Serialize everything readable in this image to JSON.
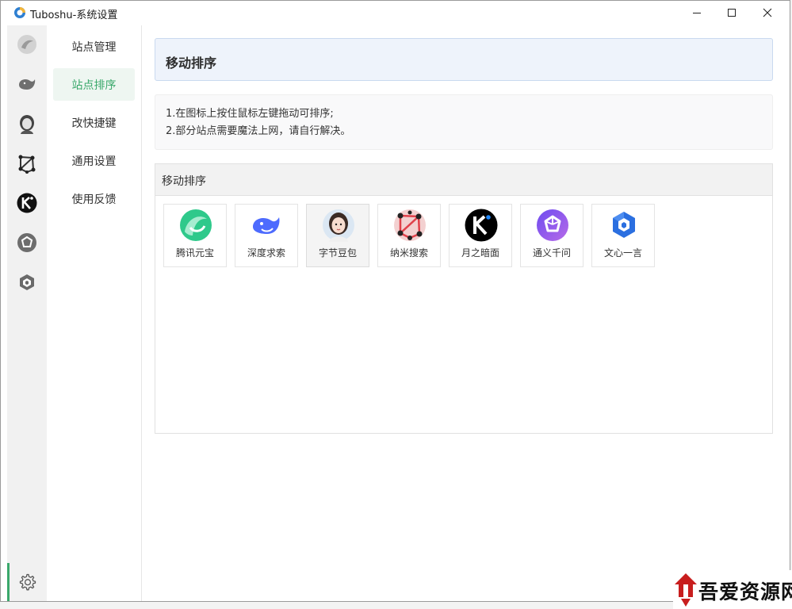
{
  "window": {
    "title": "Tuboshu-系统设置"
  },
  "title_controls": {
    "minimize": "minimize-icon",
    "maximize": "maximize-icon",
    "close": "close-icon"
  },
  "iconbar": {
    "items": [
      {
        "name": "tencent-yuanbao",
        "icon": "yuanbao-icon"
      },
      {
        "name": "deepseek",
        "icon": "deepseek-whale-icon"
      },
      {
        "name": "doubao",
        "icon": "doubao-avatar-icon"
      },
      {
        "name": "nami-search",
        "icon": "nami-network-icon"
      },
      {
        "name": "kimi",
        "icon": "kimi-k-icon"
      },
      {
        "name": "tongyi-qianwen",
        "icon": "tongyi-icon"
      },
      {
        "name": "wenxin-yiyan",
        "icon": "wenxin-cube-icon"
      }
    ],
    "settings_icon": "gear-icon"
  },
  "nav": {
    "items": [
      {
        "label": "站点管理",
        "active": false
      },
      {
        "label": "站点排序",
        "active": true
      },
      {
        "label": "改快捷键",
        "active": false
      },
      {
        "label": "通用设置",
        "active": false
      },
      {
        "label": "使用反馈",
        "active": false
      }
    ]
  },
  "main": {
    "title": "移动排序",
    "tips": [
      "1.在图标上按住鼠标左键拖动可排序;",
      "2.部分站点需要魔法上网，请自行解决。"
    ],
    "panel_title": "移动排序",
    "sites": [
      {
        "label": "腾讯元宝",
        "icon": "yuanbao-icon"
      },
      {
        "label": "深度求索",
        "icon": "deepseek-whale-icon"
      },
      {
        "label": "字节豆包",
        "icon": "doubao-avatar-icon"
      },
      {
        "label": "纳米搜索",
        "icon": "nami-network-icon"
      },
      {
        "label": "月之暗面",
        "icon": "kimi-k-icon"
      },
      {
        "label": "通义千问",
        "icon": "tongyi-icon"
      },
      {
        "label": "文心一言",
        "icon": "wenxin-cube-icon"
      }
    ]
  },
  "watermark": {
    "text": "吾爱资源网"
  },
  "colors": {
    "accent": "#3aa86b",
    "header_bg": "#eef3fb",
    "header_border": "#c9d9ef"
  }
}
